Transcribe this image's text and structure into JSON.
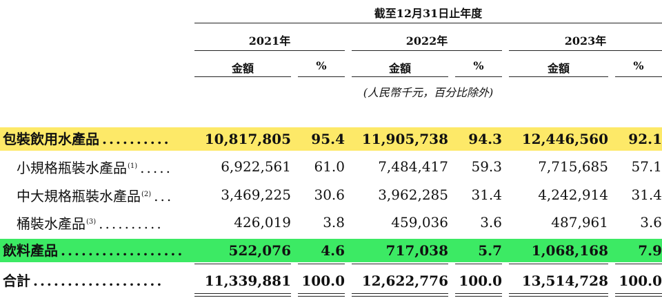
{
  "header": {
    "period": "截至12月31日止年度",
    "years": [
      "2021年",
      "2022年",
      "2023年"
    ],
    "amount_label": "金額",
    "pct_label": "%",
    "unit_note": "(人民幣千元，百分比除外)"
  },
  "rows": [
    {
      "label": "包裝飲用水產品",
      "note": "",
      "dots": "..........",
      "values": [
        "10,817,805",
        "95.4",
        "11,905,738",
        "94.3",
        "12,446,560",
        "92.1"
      ]
    },
    {
      "label": "小規格瓶裝水產品",
      "note": "(1)",
      "dots": ".....",
      "values": [
        "6,922,561",
        "61.0",
        "7,484,417",
        "59.3",
        "7,715,685",
        "57.1"
      ]
    },
    {
      "label": "中大規格瓶裝水產品",
      "note": "(2)",
      "dots": "...",
      "values": [
        "3,469,225",
        "30.6",
        "3,962,285",
        "31.4",
        "4,242,914",
        "31.4"
      ]
    },
    {
      "label": "桶裝水產品",
      "note": "(3)",
      "dots": "..........",
      "values": [
        "426,019",
        "3.8",
        "459,036",
        "3.6",
        "487,961",
        "3.6"
      ]
    },
    {
      "label": "飲料產品",
      "note": "",
      "dots": "..................",
      "values": [
        "522,076",
        "4.6",
        "717,038",
        "5.7",
        "1,068,168",
        "7.9"
      ]
    },
    {
      "label": "合計",
      "note": "",
      "dots": "...................",
      "values": [
        "11,339,881",
        "100.0",
        "12,622,776",
        "100.0",
        "13,514,728",
        "100.0"
      ]
    }
  ],
  "colors": {
    "highlight_yellow": "#fde968",
    "highlight_green": "#3cea64"
  }
}
